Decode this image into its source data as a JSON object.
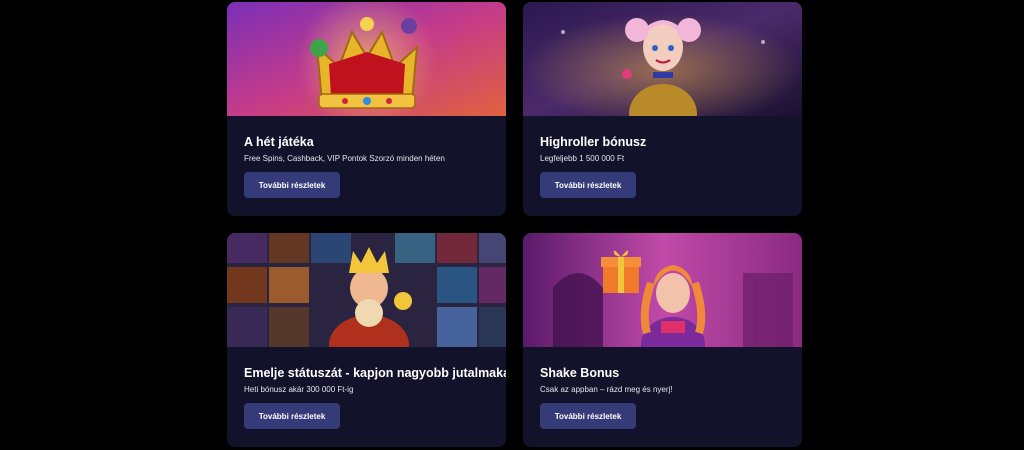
{
  "cards": [
    {
      "title": "A hét játéka",
      "subtitle": "Free Spins, Cashback, VIP Pontok Szorzó minden héten",
      "button_label": "További részletek",
      "banner_icon": "crown-icon"
    },
    {
      "title": "Highroller bónusz",
      "subtitle": "Legfeljebb 1 500 000 Ft",
      "button_label": "További részletek",
      "banner_icon": "character-icon"
    },
    {
      "title": "Emelje státuszát - kapjon nagyobb jutalmakat",
      "subtitle": "Heti bónusz akár 300 000 Ft-ig",
      "button_label": "További részletek",
      "banner_icon": "king-character-icon"
    },
    {
      "title": "Shake Bonus",
      "subtitle": "Csak az appban – rázd meg és nyerj!",
      "button_label": "További részletek",
      "banner_icon": "gift-icon"
    }
  ],
  "colors": {
    "card_bg": "#12122a",
    "button_bg": "#353a78",
    "page_bg": "#000000"
  }
}
